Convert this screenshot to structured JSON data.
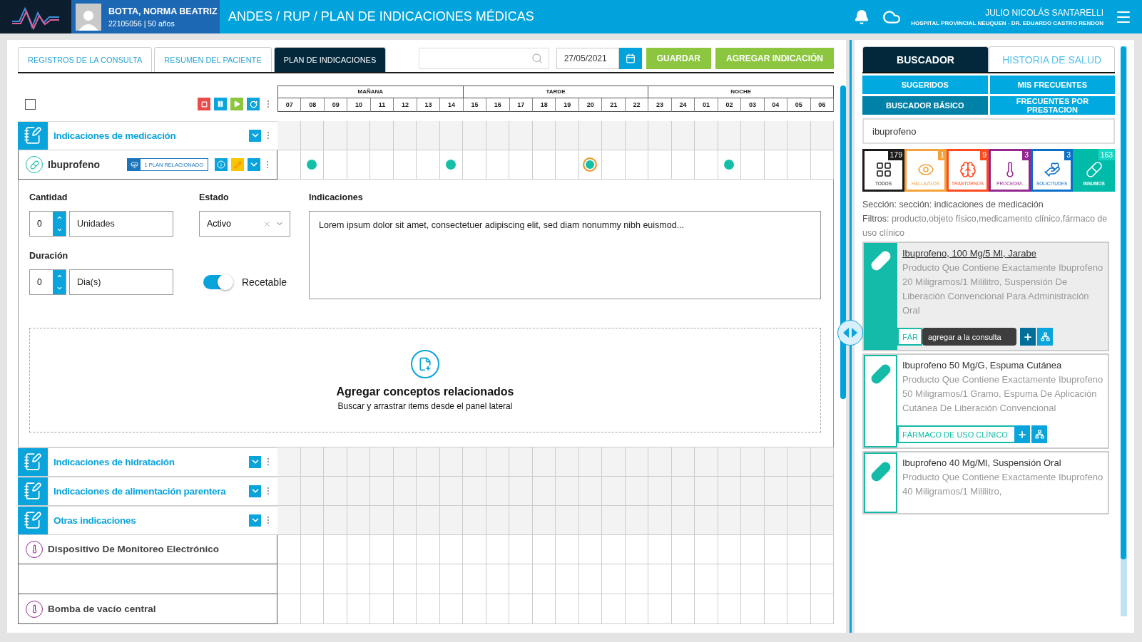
{
  "header": {
    "patient_name": "BOTTA, NORMA BEATRIZ",
    "patient_info": "22105056 | 50 años",
    "breadcrumb": "ANDES / RUP / PLAN DE INDICACIONES MÉDICAS",
    "user_name": "JULIO NICOLÁS SANTARELLI",
    "user_hospital": "HOSPITAL PROVINCIAL NEUQUEN - DR. EDUARDO CASTRO RENDON"
  },
  "tabs": [
    {
      "label": "REGISTROS DE LA CONSULTA",
      "selected": false
    },
    {
      "label": "RESUMEN  DEL PACIENTE",
      "selected": false
    },
    {
      "label": "PLAN DE INDICACIONES",
      "selected": true
    }
  ],
  "toolbar": {
    "date": "27/05/2021",
    "buttons": [
      "GUARDAR",
      "AGREGAR INDICACIÓN"
    ]
  },
  "timeline": {
    "select_all": {
      "checked": false
    },
    "periods": [
      {
        "label": "MAÑANA",
        "hours": [
          "07",
          "08",
          "09",
          "10",
          "11",
          "12",
          "13",
          "14"
        ]
      },
      {
        "label": "TARDE",
        "hours": [
          "15",
          "16",
          "17",
          "18",
          "19",
          "20",
          "21",
          "22"
        ]
      },
      {
        "label": "NOCHE",
        "hours": [
          "23",
          "24",
          "01",
          "02",
          "03",
          "04",
          "05",
          "06"
        ]
      }
    ],
    "rows": [
      {
        "kind": "section",
        "title": "Indicaciones de medicación"
      },
      {
        "kind": "medication",
        "name": "Ibuprofeno",
        "badge": "1 PLAN RELACIONADO",
        "schedule": [
          {
            "dose": false,
            "current": false
          },
          {
            "dose": true,
            "current": false
          },
          {
            "dose": false,
            "current": false
          },
          {
            "dose": false,
            "current": false
          },
          {
            "dose": false,
            "current": false
          },
          {
            "dose": false,
            "current": false
          },
          {
            "dose": false,
            "current": false
          },
          {
            "dose": true,
            "current": false
          },
          {
            "dose": false,
            "current": false
          },
          {
            "dose": false,
            "current": false
          },
          {
            "dose": false,
            "current": false
          },
          {
            "dose": false,
            "current": false
          },
          {
            "dose": false,
            "current": false
          },
          {
            "dose": true,
            "current": true
          },
          {
            "dose": false,
            "current": false
          },
          {
            "dose": false,
            "current": false
          },
          {
            "dose": false,
            "current": false
          },
          {
            "dose": false,
            "current": false
          },
          {
            "dose": false,
            "current": false
          },
          {
            "dose": true,
            "current": false
          },
          {
            "dose": false,
            "current": false
          },
          {
            "dose": false,
            "current": false
          },
          {
            "dose": false,
            "current": false
          },
          {
            "dose": false,
            "current": false
          }
        ],
        "detail": {
          "quantity_label": "Cantidad",
          "quantity": "0",
          "unit": "Unidades",
          "state_label": "Estado",
          "state": "Activo",
          "duration_label": "Duración",
          "duration": "0",
          "duration_unit": "Dia(s)",
          "prescribable": {
            "label": "Recetable",
            "on": true
          },
          "indications_label": "Indicaciones",
          "indications": "Lorem ipsum dolor sit amet, consectetuer adipiscing elit, sed diam nonummy nibh euismod...",
          "dropzone_title": "Agregar conceptos relacionados",
          "dropzone_subtitle": "Buscar y arrastrar items desde el panel lateral"
        }
      },
      {
        "kind": "section",
        "title": "Indicaciones de hidratación"
      },
      {
        "kind": "section",
        "title": "Indicaciones de alimentación parentera"
      },
      {
        "kind": "section",
        "title": "Otras indicaciones"
      },
      {
        "kind": "device",
        "name": "Dispositivo De Monitoreo Electrónico"
      },
      {
        "kind": "empty"
      },
      {
        "kind": "device",
        "name": "Bomba de vacío central"
      }
    ]
  },
  "search_panel": {
    "tabs": [
      {
        "label": "BUSCADOR",
        "selected": true
      },
      {
        "label": "HISTORIA DE SALUD",
        "selected": false
      }
    ],
    "filters": [
      {
        "label": "SUGERIDOS",
        "selected": false
      },
      {
        "label": "MIS FRECUENTES",
        "selected": false
      },
      {
        "label": "BUSCADOR BÁSICO",
        "selected": true
      },
      {
        "label": "FRECUENTES POR PRESTACION",
        "selected": false
      }
    ],
    "query": "ibuprofeno",
    "categories": [
      {
        "kind": "all",
        "label": "TODOS",
        "count": "179",
        "color": "#1a1a1a",
        "selected": false
      },
      {
        "kind": "findings",
        "label": "HALLAZGOS",
        "count": "1",
        "color": "#f4a23b",
        "selected": false
      },
      {
        "kind": "disorders",
        "label": "TRASTORNOS",
        "count": "9",
        "color": "#ff4a1f",
        "selected": false
      },
      {
        "kind": "procedures",
        "label": "PROCEDIM.",
        "count": "3",
        "color": "#92278f",
        "selected": false
      },
      {
        "kind": "requests",
        "label": "SOLICITUDES",
        "count": "3",
        "color": "#0a6fc8",
        "selected": false
      },
      {
        "kind": "supplies",
        "label": "INSUMOS",
        "count": "163",
        "color": "#00bba7",
        "selected": true
      }
    ],
    "section_text": "Sección: sección: indicaciones de medicación",
    "filters_label": "Filtros:",
    "filters_value": "producto,objeto físico,medicamento clínico,fármaco de uso clínico",
    "results": [
      {
        "title": "Ibuprofeno, 100 Mg/5 Ml, Jarabe",
        "description": "Producto Que Contiene Exactamente Ibuprofeno 20 Miligramos/1 Mililitro, Suspensión De Liberación Convencional Para Administración Oral",
        "tag": "FÁR",
        "selected": true,
        "tooltip": "agregar a la consulta"
      },
      {
        "title": "Ibuprofeno 50 Mg/G, Espuma Cutánea",
        "description": "Producto Que Contiene Exactamente Ibuprofeno 50 Miligramos/1 Gramo, Espuma De Aplicación Cutánea De Liberación Convencional",
        "tag": "FÁRMACO DE USO CLÍNICO",
        "selected": false
      },
      {
        "title": "Ibuprofeno 40 Mg/Ml, Suspensión Oral",
        "description": "Producto Que Contiene Exactamente Ibuprofeno 40 Miligramos/1 Mililitro,",
        "selected": false
      }
    ]
  }
}
